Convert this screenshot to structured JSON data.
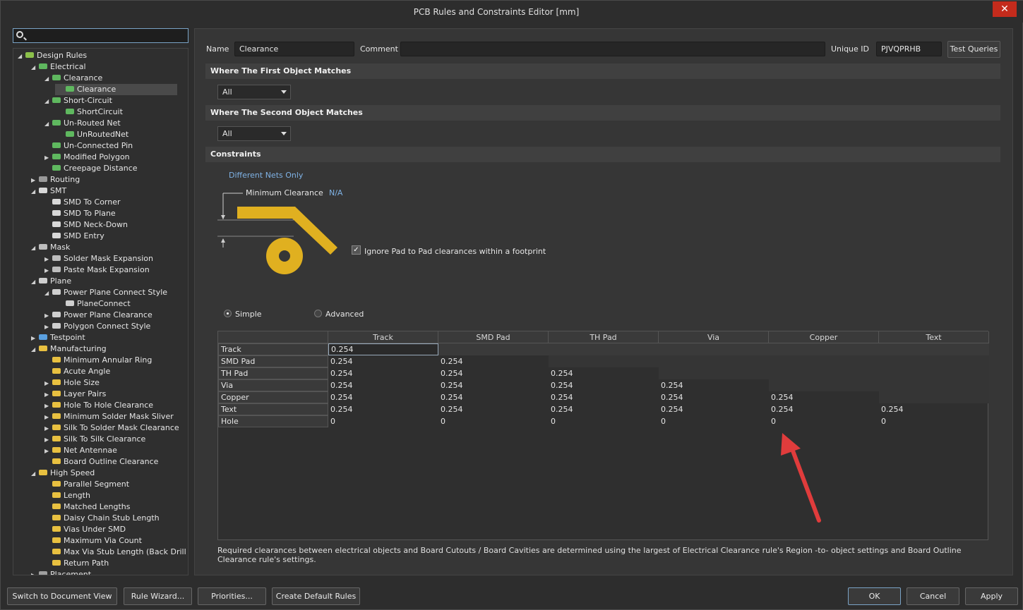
{
  "window": {
    "title": "PCB Rules and Constraints Editor [mm]",
    "close_glyph": "✕"
  },
  "search": {
    "value": ""
  },
  "tree": [
    {
      "label": "Design Rules",
      "depth": 0,
      "arrow": "◢",
      "icon": "rules-icon"
    },
    {
      "label": "Electrical",
      "depth": 1,
      "arrow": "◢",
      "icon": "electrical-icon"
    },
    {
      "label": "Clearance",
      "depth": 2,
      "arrow": "◢",
      "icon": "electrical-icon"
    },
    {
      "label": "Clearance",
      "depth": 3,
      "arrow": "",
      "icon": "electrical-icon",
      "selected": true
    },
    {
      "label": "Short-Circuit",
      "depth": 2,
      "arrow": "◢",
      "icon": "electrical-icon"
    },
    {
      "label": "ShortCircuit",
      "depth": 3,
      "arrow": "",
      "icon": "electrical-icon"
    },
    {
      "label": "Un-Routed Net",
      "depth": 2,
      "arrow": "◢",
      "icon": "electrical-icon"
    },
    {
      "label": "UnRoutedNet",
      "depth": 3,
      "arrow": "",
      "icon": "electrical-icon"
    },
    {
      "label": "Un-Connected Pin",
      "depth": 2,
      "arrow": "",
      "icon": "electrical-icon"
    },
    {
      "label": "Modified Polygon",
      "depth": 2,
      "arrow": "▶",
      "icon": "electrical-icon"
    },
    {
      "label": "Creepage Distance",
      "depth": 2,
      "arrow": "",
      "icon": "electrical-icon"
    },
    {
      "label": "Routing",
      "depth": 1,
      "arrow": "▶",
      "icon": "routing-icon"
    },
    {
      "label": "SMT",
      "depth": 1,
      "arrow": "◢",
      "icon": "smt-icon"
    },
    {
      "label": "SMD To Corner",
      "depth": 2,
      "arrow": "",
      "icon": "smt-icon"
    },
    {
      "label": "SMD To Plane",
      "depth": 2,
      "arrow": "",
      "icon": "smt-icon"
    },
    {
      "label": "SMD Neck-Down",
      "depth": 2,
      "arrow": "",
      "icon": "smt-icon"
    },
    {
      "label": "SMD Entry",
      "depth": 2,
      "arrow": "",
      "icon": "smt-icon"
    },
    {
      "label": "Mask",
      "depth": 1,
      "arrow": "◢",
      "icon": "mask-icon"
    },
    {
      "label": "Solder Mask Expansion",
      "depth": 2,
      "arrow": "▶",
      "icon": "mask-icon"
    },
    {
      "label": "Paste Mask Expansion",
      "depth": 2,
      "arrow": "▶",
      "icon": "mask-icon"
    },
    {
      "label": "Plane",
      "depth": 1,
      "arrow": "◢",
      "icon": "plane-icon"
    },
    {
      "label": "Power Plane Connect Style",
      "depth": 2,
      "arrow": "◢",
      "icon": "plane-icon"
    },
    {
      "label": "PlaneConnect",
      "depth": 3,
      "arrow": "",
      "icon": "plane-icon"
    },
    {
      "label": "Power Plane Clearance",
      "depth": 2,
      "arrow": "▶",
      "icon": "plane-icon"
    },
    {
      "label": "Polygon Connect Style",
      "depth": 2,
      "arrow": "▶",
      "icon": "plane-icon"
    },
    {
      "label": "Testpoint",
      "depth": 1,
      "arrow": "▶",
      "icon": "testpoint-icon"
    },
    {
      "label": "Manufacturing",
      "depth": 1,
      "arrow": "◢",
      "icon": "manufacturing-icon"
    },
    {
      "label": "Minimum Annular Ring",
      "depth": 2,
      "arrow": "",
      "icon": "manufacturing-icon"
    },
    {
      "label": "Acute Angle",
      "depth": 2,
      "arrow": "",
      "icon": "manufacturing-icon"
    },
    {
      "label": "Hole Size",
      "depth": 2,
      "arrow": "▶",
      "icon": "manufacturing-icon"
    },
    {
      "label": "Layer Pairs",
      "depth": 2,
      "arrow": "▶",
      "icon": "manufacturing-icon"
    },
    {
      "label": "Hole To Hole Clearance",
      "depth": 2,
      "arrow": "▶",
      "icon": "manufacturing-icon"
    },
    {
      "label": "Minimum Solder Mask Sliver",
      "depth": 2,
      "arrow": "▶",
      "icon": "manufacturing-icon"
    },
    {
      "label": "Silk To Solder Mask Clearance",
      "depth": 2,
      "arrow": "▶",
      "icon": "manufacturing-icon"
    },
    {
      "label": "Silk To Silk Clearance",
      "depth": 2,
      "arrow": "▶",
      "icon": "manufacturing-icon"
    },
    {
      "label": "Net Antennae",
      "depth": 2,
      "arrow": "▶",
      "icon": "manufacturing-icon"
    },
    {
      "label": "Board Outline Clearance",
      "depth": 2,
      "arrow": "",
      "icon": "manufacturing-icon"
    },
    {
      "label": "High Speed",
      "depth": 1,
      "arrow": "◢",
      "icon": "highspeed-icon"
    },
    {
      "label": "Parallel Segment",
      "depth": 2,
      "arrow": "",
      "icon": "highspeed-icon"
    },
    {
      "label": "Length",
      "depth": 2,
      "arrow": "",
      "icon": "highspeed-icon"
    },
    {
      "label": "Matched Lengths",
      "depth": 2,
      "arrow": "",
      "icon": "highspeed-icon"
    },
    {
      "label": "Daisy Chain Stub Length",
      "depth": 2,
      "arrow": "",
      "icon": "highspeed-icon"
    },
    {
      "label": "Vias Under SMD",
      "depth": 2,
      "arrow": "",
      "icon": "highspeed-icon"
    },
    {
      "label": "Maximum Via Count",
      "depth": 2,
      "arrow": "",
      "icon": "highspeed-icon"
    },
    {
      "label": "Max Via Stub Length (Back Drill",
      "depth": 2,
      "arrow": "",
      "icon": "highspeed-icon"
    },
    {
      "label": "Return Path",
      "depth": 2,
      "arrow": "",
      "icon": "highspeed-icon"
    },
    {
      "label": "Placement",
      "depth": 1,
      "arrow": "▶",
      "icon": "placement-icon"
    }
  ],
  "rule": {
    "name_label": "Name",
    "name_value": "Clearance",
    "comment_label": "Comment",
    "comment_value": "",
    "uid_label": "Unique ID",
    "uid_value": "PJVQPRHB",
    "test_queries": "Test Queries"
  },
  "first_match": {
    "heading": "Where The First Object Matches",
    "value": "All"
  },
  "second_match": {
    "heading": "Where The Second Object Matches",
    "value": "All"
  },
  "constraints": {
    "heading": "Constraints",
    "net_scope": "Different Nets Only",
    "min_clearance_label": "Minimum Clearance",
    "min_clearance_value": "N/A",
    "ignore_pad_label": "Ignore Pad to Pad clearances within a footprint",
    "ignore_pad_checked": true,
    "mode_simple": "Simple",
    "mode_advanced": "Advanced"
  },
  "grid": {
    "columns": [
      "Track",
      "SMD Pad",
      "TH Pad",
      "Via",
      "Copper",
      "Text"
    ],
    "rows": [
      {
        "label": "Track",
        "cells": [
          "0.254",
          "",
          "",
          "",
          "",
          ""
        ]
      },
      {
        "label": "SMD Pad",
        "cells": [
          "0.254",
          "0.254",
          "",
          "",
          "",
          ""
        ]
      },
      {
        "label": "TH Pad",
        "cells": [
          "0.254",
          "0.254",
          "0.254",
          "",
          "",
          ""
        ]
      },
      {
        "label": "Via",
        "cells": [
          "0.254",
          "0.254",
          "0.254",
          "0.254",
          "",
          ""
        ]
      },
      {
        "label": "Copper",
        "cells": [
          "0.254",
          "0.254",
          "0.254",
          "0.254",
          "0.254",
          ""
        ]
      },
      {
        "label": "Text",
        "cells": [
          "0.254",
          "0.254",
          "0.254",
          "0.254",
          "0.254",
          "0.254"
        ]
      },
      {
        "label": "Hole",
        "cells": [
          "0",
          "0",
          "0",
          "0",
          "0",
          "0"
        ]
      }
    ]
  },
  "note": "Required clearances between electrical objects and Board Cutouts / Board Cavities are determined using the largest of Electrical Clearance rule's Region -to- object settings and Board Outline Clearance rule's settings.",
  "buttons": {
    "switch_view": "Switch to Document View",
    "rule_wizard": "Rule Wizard...",
    "priorities": "Priorities...",
    "create_default": "Create Default Rules",
    "ok": "OK",
    "cancel": "Cancel",
    "apply": "Apply"
  },
  "colors": {
    "accent_arrow": "#e03c3c",
    "pad_gold": "#e0b020"
  }
}
